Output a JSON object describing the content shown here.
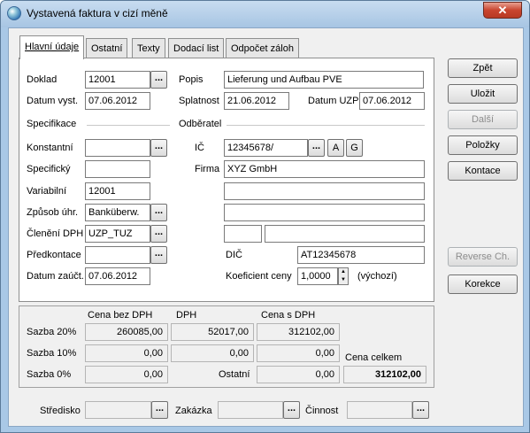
{
  "window": {
    "title": "Vystavená faktura v cizí měně",
    "close_glyph": "✕"
  },
  "tabs": [
    "Hlavní údaje",
    "Ostatní",
    "Texty",
    "Dodací list",
    "Odpočet záloh"
  ],
  "header": {
    "doklad_label": "Doklad",
    "doklad_value": "12001",
    "popis_label": "Popis",
    "popis_value": "Lieferung und Aufbau PVE",
    "datum_vyst_label": "Datum vyst.",
    "datum_vyst_value": "07.06.2012",
    "splatnost_label": "Splatnost",
    "splatnost_value": "21.06.2012",
    "datum_uzp_label": "Datum UZP",
    "datum_uzp_value": "07.06.2012"
  },
  "specifikace": {
    "section_label": "Specifikace",
    "konstantni_label": "Konstantní",
    "konstantni_value": "",
    "specificky_label": "Specifický",
    "specificky_value": "",
    "variabilni_label": "Variabilní",
    "variabilni_value": "12001",
    "zpusob_label": "Způsob úhr.",
    "zpusob_value": "Banküberw.",
    "cleneni_label": "Členění DPH",
    "cleneni_value": "UZP_TUZ",
    "predkontace_label": "Předkontace",
    "predkontace_value": "",
    "datum_zauct_label": "Datum zaúčt.",
    "datum_zauct_value": "07.06.2012"
  },
  "odberatel": {
    "section_label": "Odběratel",
    "ic_label": "IČ",
    "ic_value": "12345678/",
    "btn_a": "A",
    "btn_g": "G",
    "firma_label": "Firma",
    "firma_value": "XYZ GmbH",
    "line1": "",
    "line2": "",
    "line3a": "",
    "line3b": "",
    "dic_label": "DIČ",
    "dic_value": "AT12345678",
    "koef_label": "Koeficient ceny",
    "koef_value": "1,0000",
    "koef_note": "(výchozí)"
  },
  "vat": {
    "col1": "Cena bez DPH",
    "col2": "DPH",
    "col3": "Cena s DPH",
    "r1_label": "Sazba 20%",
    "r1_base": "260085,00",
    "r1_vat": "52017,00",
    "r1_total": "312102,00",
    "r2_label": "Sazba 10%",
    "r2_base": "0,00",
    "r2_vat": "0,00",
    "r2_total": "0,00",
    "r3_label": "Sazba 0%",
    "r3_base": "0,00",
    "ostatni_label": "Ostatní",
    "ostatni_value": "0,00",
    "celkem_label": "Cena celkem",
    "celkem_value": "312102,00"
  },
  "bottom": {
    "stredisko_label": "Středisko",
    "zakazka_label": "Zakázka",
    "cinnost_label": "Činnost"
  },
  "buttons": {
    "zpet": "Zpět",
    "ulozit": "Uložit",
    "dalsi": "Další",
    "polozky": "Položky",
    "kontace": "Kontace",
    "reverse": "Reverse Ch.",
    "korekce": "Korekce"
  },
  "dots": "..."
}
